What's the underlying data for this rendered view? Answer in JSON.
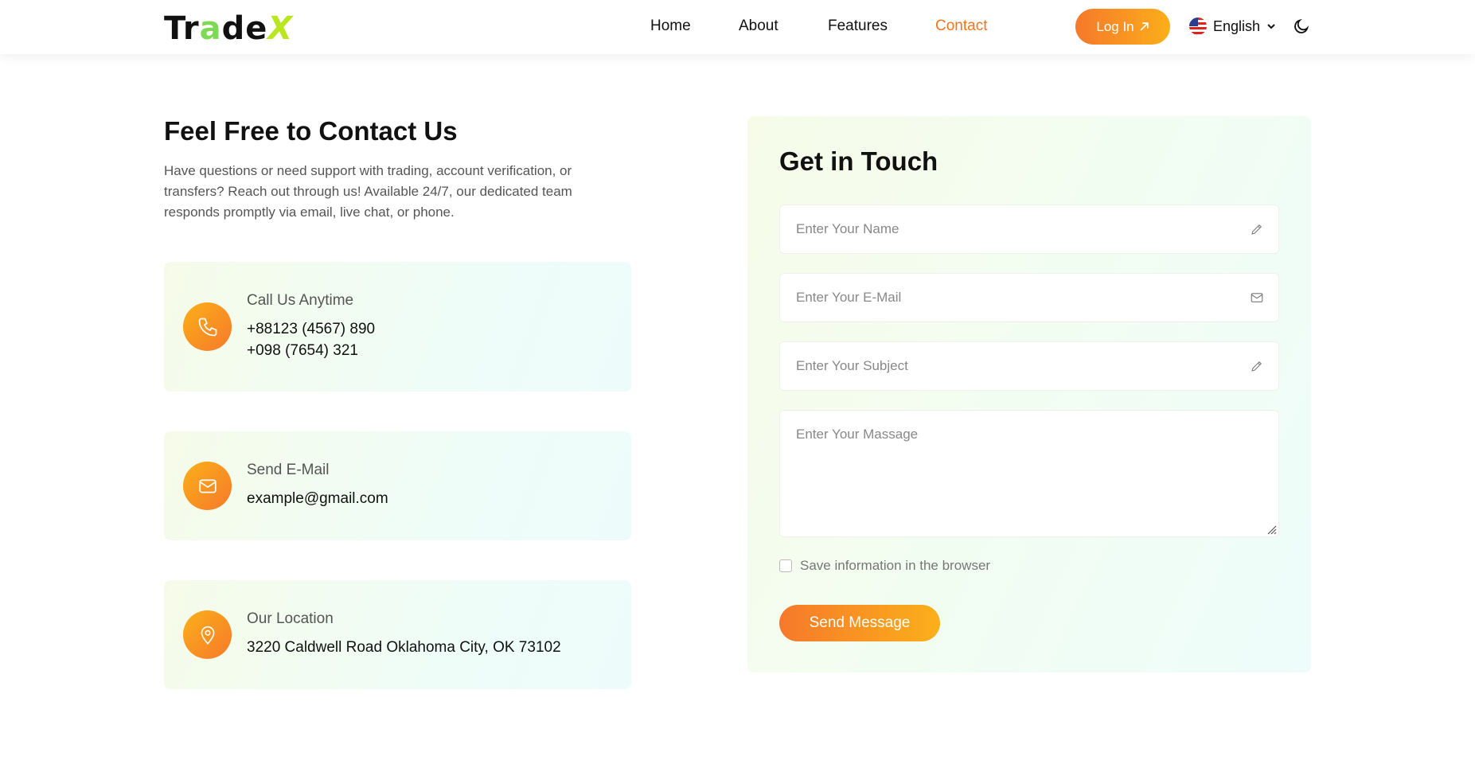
{
  "brand": {
    "logo_parts": [
      "Tr",
      "a",
      "de",
      "X"
    ]
  },
  "nav": {
    "items": [
      {
        "label": "Home",
        "active": false
      },
      {
        "label": "About",
        "active": false
      },
      {
        "label": "Features",
        "active": false
      },
      {
        "label": "Contact",
        "active": true
      }
    ],
    "login_label": "Log In",
    "language": "English"
  },
  "contact_info": {
    "title": "Feel Free to Contact Us",
    "description": "Have questions or need support with trading, account verification, or transfers? Reach out through us! Available 24/7, our dedicated team responds promptly via email, live chat, or phone.",
    "cards": [
      {
        "label": "Call Us Anytime",
        "values": [
          "+88123 (4567) 890",
          "+098 (7654) 321"
        ],
        "icon": "phone-icon"
      },
      {
        "label": "Send E-Mail",
        "values": [
          "example@gmail.com"
        ],
        "icon": "mail-icon"
      },
      {
        "label": "Our Location",
        "values": [
          "3220 Caldwell Road Oklahoma City, OK 73102"
        ],
        "icon": "location-pin-icon"
      }
    ]
  },
  "form": {
    "title": "Get in Touch",
    "name_placeholder": "Enter Your Name",
    "email_placeholder": "Enter Your E-Mail",
    "subject_placeholder": "Enter Your Subject",
    "message_placeholder": "Enter Your Massage",
    "save_label": "Save information in the browser",
    "save_checked": false,
    "submit_label": "Send Message"
  },
  "colors": {
    "accent": "#f2741c",
    "gradient_start": "#f6792a",
    "gradient_end": "#fbb01a"
  }
}
